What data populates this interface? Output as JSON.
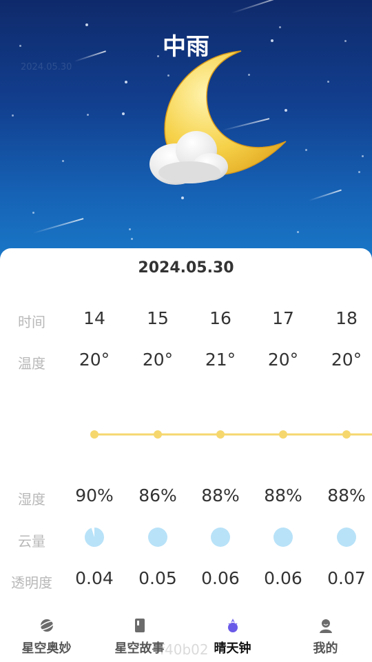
{
  "header": {
    "condition": "中雨",
    "faint_text": "2024.05.30"
  },
  "date": "2024.05.30",
  "labels": {
    "time": "时间",
    "temp": "温度",
    "humidity": "湿度",
    "cloud": "云量",
    "transparency": "透明度"
  },
  "hours": [
    "14",
    "15",
    "16",
    "17",
    "18"
  ],
  "temps": [
    "20°",
    "20°",
    "21°",
    "20°",
    "20°"
  ],
  "temp_values": [
    20,
    20,
    21,
    20,
    20
  ],
  "humidity": [
    "90%",
    "86%",
    "88%",
    "88%",
    "88%"
  ],
  "cloud_cover": [
    0.95,
    1.0,
    1.0,
    1.0,
    1.0
  ],
  "transparency": [
    "0.04",
    "0.05",
    "0.06",
    "0.06",
    "0.07"
  ],
  "colors": {
    "accent_line": "#f5d76e",
    "cloud_fill": "#b8e2f8",
    "sky_top": "#0f2a6b",
    "sky_bottom": "#1a78c8"
  },
  "nav": {
    "items": [
      {
        "label": "星空奥妙",
        "icon": "planet-icon"
      },
      {
        "label": "星空故事",
        "icon": "book-icon"
      },
      {
        "label": "晴天钟",
        "icon": "weather-clock-icon"
      },
      {
        "label": "我的",
        "icon": "user-icon"
      }
    ],
    "active": 2
  },
  "watermark": "f40b02"
}
